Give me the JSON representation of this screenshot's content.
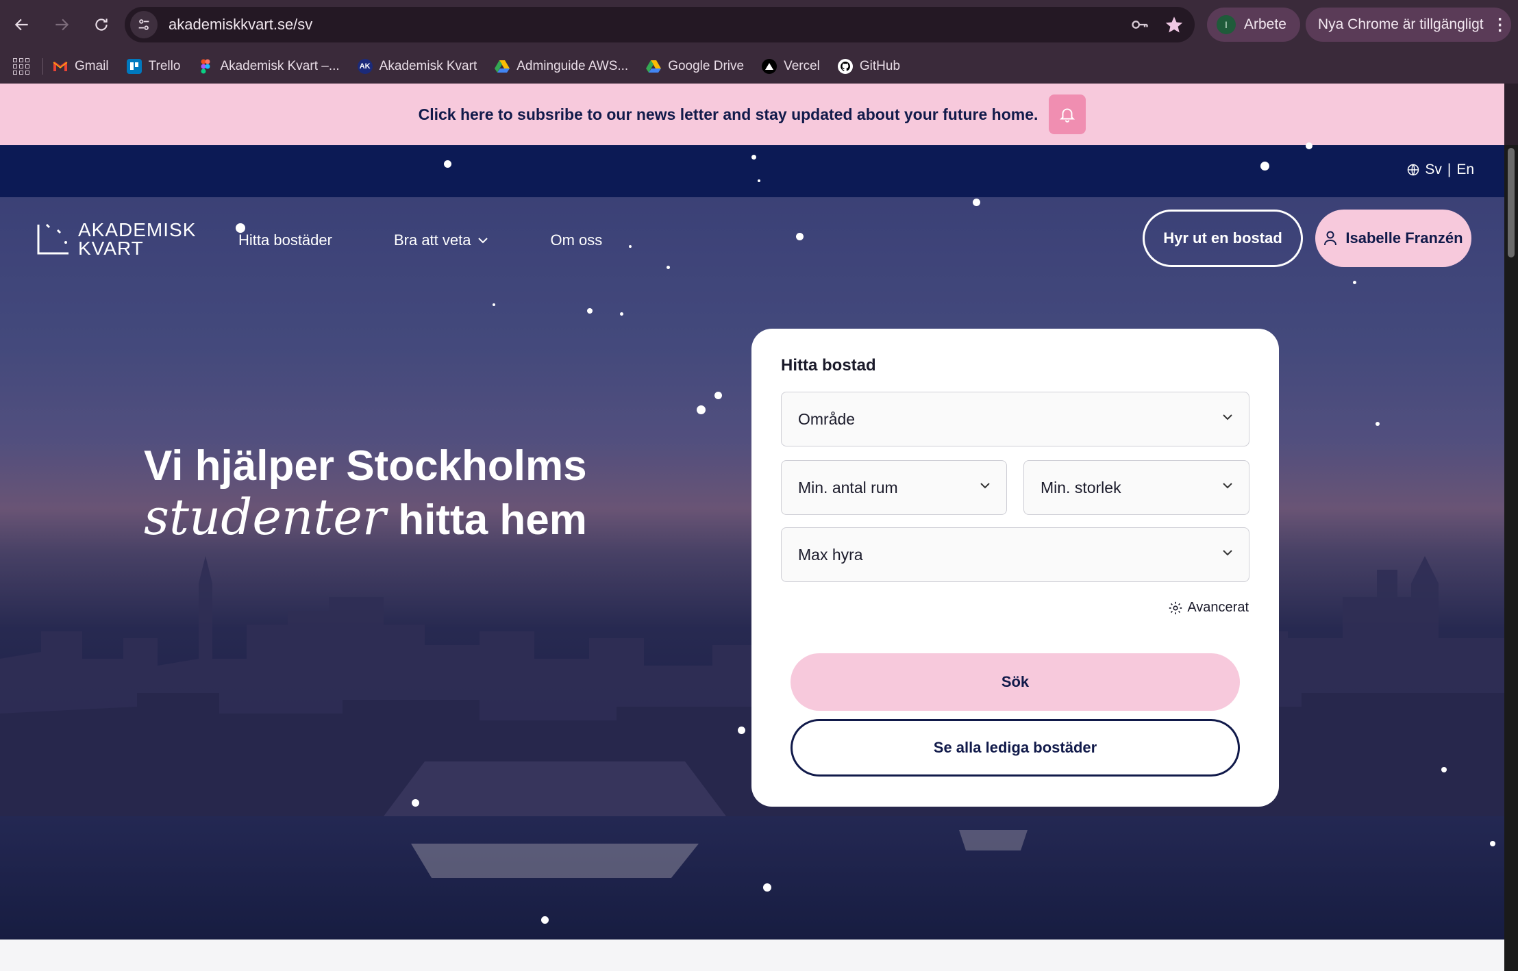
{
  "browser": {
    "url": "akademiskkvart.se/sv",
    "profile_initial": "I",
    "profile_name": "Arbete",
    "update_label": "Nya Chrome är tillgängligt",
    "bookmarks": [
      {
        "label": "Gmail",
        "icon": "gmail-icon",
        "color": "#ea4335"
      },
      {
        "label": "Trello",
        "icon": "trello-icon",
        "color": "#0079bf"
      },
      {
        "label": "Akademisk Kvart –...",
        "icon": "figma-icon",
        "color": "#f24e1e"
      },
      {
        "label": "Akademisk Kvart",
        "icon": "ak-icon",
        "color": "#1b2a7a"
      },
      {
        "label": "Adminguide AWS...",
        "icon": "drive-icon",
        "color": "#34a853"
      },
      {
        "label": "Google Drive",
        "icon": "drive-icon",
        "color": "#fbbc04"
      },
      {
        "label": "Vercel",
        "icon": "vercel-icon",
        "color": "#000000"
      },
      {
        "label": "GitHub",
        "icon": "github-icon",
        "color": "#ffffff"
      }
    ],
    "ak_favicon_text": "AK"
  },
  "newsletter": {
    "text": "Click here to subsribe to our news letter and stay updated about your future home."
  },
  "language": {
    "sv": "Sv",
    "separator": "|",
    "en": "En"
  },
  "header": {
    "logo_line1": "AKADEMISK",
    "logo_line2": "KVART",
    "nav": {
      "find": "Hitta bostäder",
      "good_to_know": "Bra att veta",
      "about": "Om oss"
    },
    "rent_out": "Hyr ut en bostad",
    "user_name": "Isabelle Franzén"
  },
  "hero": {
    "line1": "Vi hjälper Stockholms",
    "line2_emphasis": "studenter",
    "line2_rest": "hitta hem"
  },
  "search": {
    "title": "Hitta bostad",
    "area": "Område",
    "min_rooms": "Min. antal rum",
    "min_size": "Min. storlek",
    "max_rent": "Max hyra",
    "advanced": "Avancerat",
    "search_button": "Sök",
    "see_all_button": "Se alla lediga bostäder"
  },
  "colors": {
    "brand_navy": "#111a4a",
    "brand_pink": "#f7c9dc",
    "bell_pink": "#f08eb1"
  }
}
